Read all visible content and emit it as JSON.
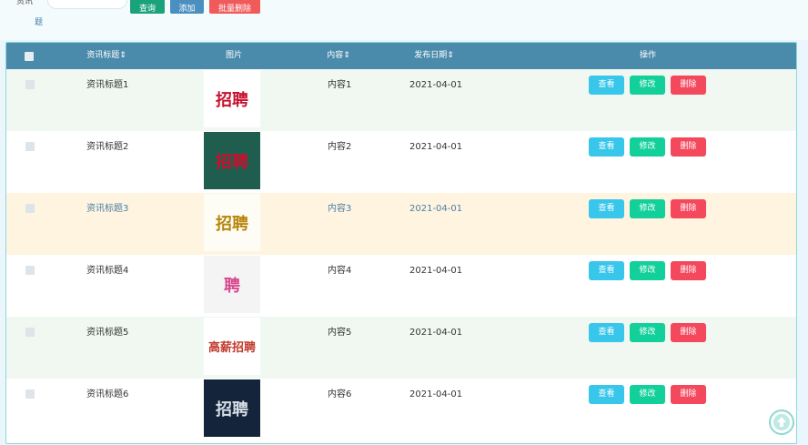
{
  "filter": {
    "label_part": "资讯",
    "label_part2": "题",
    "search_button": "查询",
    "add_button": "添加",
    "batch_delete_button": "批量删除"
  },
  "table": {
    "headers": {
      "title": "资讯标题⇕",
      "image": "图片",
      "content": "内容⇕",
      "date": "发布日期⇕",
      "actions": "操作"
    },
    "actions": {
      "view": "查看",
      "edit": "修改",
      "delete": "删除"
    },
    "rows": [
      {
        "title": "资讯标题1",
        "content": "内容1",
        "date": "2021-04-01",
        "thumb_text": "招聘",
        "bg": "#f1f8f1",
        "thumb_bg": "#ffffff",
        "thumb_fg": "#c8102e",
        "highlight": false
      },
      {
        "title": "资讯标题2",
        "content": "内容2",
        "date": "2021-04-01",
        "thumb_text": "招聘",
        "bg": "#ffffff",
        "thumb_bg": "#1f5e4e",
        "thumb_fg": "#c8102e",
        "highlight": false
      },
      {
        "title": "资讯标题3",
        "content": "内容3",
        "date": "2021-04-01",
        "thumb_text": "招聘",
        "bg": "#fff4e0",
        "thumb_bg": "#fdfdf6",
        "thumb_fg": "#b8860b",
        "highlight": true
      },
      {
        "title": "资讯标题4",
        "content": "内容4",
        "date": "2021-04-01",
        "thumb_text": "聘",
        "bg": "#ffffff",
        "thumb_bg": "#f4f4f4",
        "thumb_fg": "#d9468f",
        "highlight": false
      },
      {
        "title": "资讯标题5",
        "content": "内容5",
        "date": "2021-04-01",
        "thumb_text": "高薪招聘",
        "bg": "#f1f8f1",
        "thumb_bg": "#ffffff",
        "thumb_fg": "#c0392b",
        "highlight": false
      },
      {
        "title": "资讯标题6",
        "content": "内容6",
        "date": "2021-04-01",
        "thumb_text": "招聘",
        "bg": "#ffffff",
        "thumb_bg": "#14243a",
        "thumb_fg": "#d7dee6",
        "highlight": false
      }
    ]
  }
}
